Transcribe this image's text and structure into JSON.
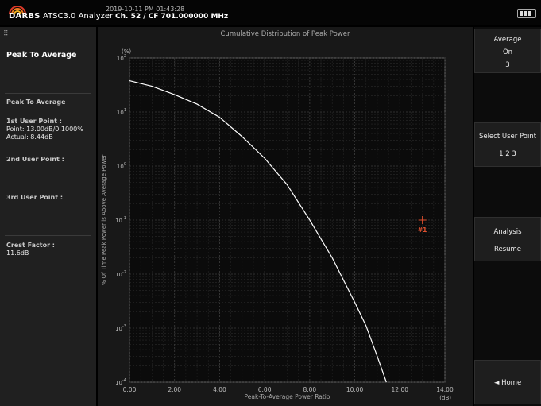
{
  "header": {
    "logo_text": "DARBS",
    "app_name": "ATSC3.0 Analyzer",
    "timestamp": "2019-10-11 PM 01:43:28",
    "channel": "Ch. 52 / CF 701.000000 MHz",
    "battery_icon": "battery-icon"
  },
  "left_panel": {
    "title": "Peak To Average",
    "section_label": "Peak To Average",
    "first_point_label": "1st User Point :",
    "first_point_value": "Point: 13.00dB/0.1000%",
    "first_point_actual": "Actual: 8.44dB",
    "second_point_label": "2nd User Point :",
    "third_point_label": "3rd User Point :",
    "crest_label": "Crest Factor :",
    "crest_value": "11.6dB"
  },
  "chart": {
    "title": "Cumulative Distribution of Peak Power",
    "marker_label": "#1"
  },
  "chart_data": {
    "type": "line",
    "title": "Cumulative Distribution of Peak Power",
    "xlabel": "Peak-To-Average Power Ratio",
    "xunit": "(dB)",
    "ylabel": "% Of Time Peak Power is Above Average Power",
    "yunit": "(%)",
    "xlim": [
      0,
      14
    ],
    "ylim": [
      0.0001,
      100
    ],
    "yscale": "log",
    "grid": true,
    "x_ticks": [
      "0.00",
      "2.00",
      "4.00",
      "6.00",
      "8.00",
      "10.00",
      "12.00",
      "14.00"
    ],
    "y_ticks": [
      {
        "value": 100,
        "base": "10",
        "exp": "2"
      },
      {
        "value": 10,
        "base": "10",
        "exp": "1"
      },
      {
        "value": 1,
        "base": "10",
        "exp": "0"
      },
      {
        "value": 0.1,
        "base": "10",
        "exp": "-1"
      },
      {
        "value": 0.01,
        "base": "10",
        "exp": "-2"
      },
      {
        "value": 0.001,
        "base": "10",
        "exp": "-3"
      },
      {
        "value": 0.0001,
        "base": "10",
        "exp": "-4"
      }
    ],
    "series": [
      {
        "color": "#ffffff",
        "x": [
          0.0,
          1.0,
          2.0,
          3.0,
          4.0,
          5.0,
          6.0,
          7.0,
          8.0,
          9.0,
          10.0,
          10.5,
          11.0,
          11.4
        ],
        "y": [
          38,
          30,
          21,
          14,
          8,
          3.5,
          1.4,
          0.45,
          0.1,
          0.02,
          0.003,
          0.0011,
          0.0003,
          0.0001
        ]
      }
    ],
    "marker": {
      "x": 13.0,
      "y": 0.1,
      "label": "#1",
      "color": "#e0502f"
    }
  },
  "right_panel": {
    "average_label": "Average",
    "average_state": "On",
    "average_count": "3",
    "select_label": "Select User Point",
    "select_options": "1  2  3",
    "analysis_label": "Analysis",
    "analysis_action": "Resume",
    "home_label": "◄ Home"
  }
}
